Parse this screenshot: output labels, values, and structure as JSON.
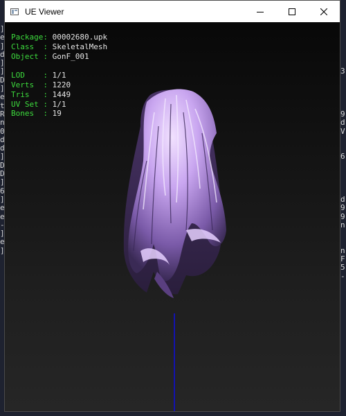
{
  "window": {
    "title": "UE Viewer",
    "controls": {
      "minimize": "minimize-icon",
      "maximize": "maximize-icon",
      "close": "close-icon"
    }
  },
  "info": {
    "package_label": "Package:",
    "package_value": "00002680.upk",
    "class_label": "Class  :",
    "class_value": "SkeletalMesh",
    "object_label": "Object :",
    "object_value": "GonF_001",
    "lod_label": "LOD    :",
    "lod_value": "1/1",
    "verts_label": "Verts  :",
    "verts_value": "1220",
    "tris_label": "Tris   :",
    "tris_value": "1449",
    "uvset_label": "UV Set :",
    "uvset_value": "1/1",
    "bones_label": "Bones  :",
    "bones_value": "19"
  },
  "background_console": {
    "left": "]\ne\n]\nd\n]\n]\nD\n]\ne\nt\nR\nn\n0\nd\nd\n]\nD\nD\n]\n6\n]\ne\ne\n-\n]\ne\n]",
    "right": "\n\n\n\n\n3\n\n\n\n\n9\nd\nV\n\n\n6\n\n\n\n\nd\n9\n9\nn\n\n\nn\nF\n5\n-"
  },
  "colors": {
    "label_green": "#3ddc3d",
    "value_white": "#e6e6e6",
    "hair_lavender": "#c9a6f0",
    "axis_blue": "#1212b0"
  }
}
